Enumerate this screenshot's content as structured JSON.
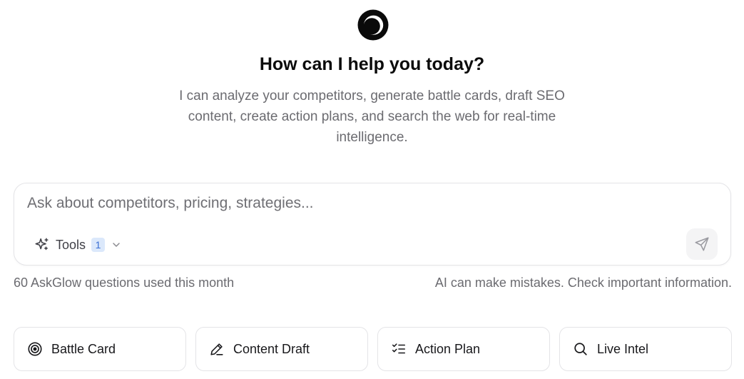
{
  "hero": {
    "logo_icon": "ring-logo-icon",
    "title": "How can I help you today?",
    "subtitle": "I can analyze your competitors, generate battle cards, draft SEO content, create action plans, and search the web for real-time intelligence."
  },
  "composer": {
    "placeholder": "Ask about competitors, pricing, strategies...",
    "value": "",
    "tools_label": "Tools",
    "tools_count": "1",
    "tools_icon": "sparkles-icon",
    "send_icon": "send-icon"
  },
  "footer": {
    "usage": "60 AskGlow questions used this month",
    "disclaimer": "AI can make mistakes. Check important information."
  },
  "quick_actions": [
    {
      "label": "Battle Card",
      "icon": "target-icon"
    },
    {
      "label": "Content Draft",
      "icon": "pencil-icon"
    },
    {
      "label": "Action Plan",
      "icon": "checklist-icon"
    },
    {
      "label": "Live Intel",
      "icon": "search-icon"
    }
  ],
  "colors": {
    "accent_badge_bg": "#dbe8fb",
    "accent_badge_text": "#3b6fd4",
    "muted_text": "#6b6b70",
    "border": "#e4e4e7"
  }
}
